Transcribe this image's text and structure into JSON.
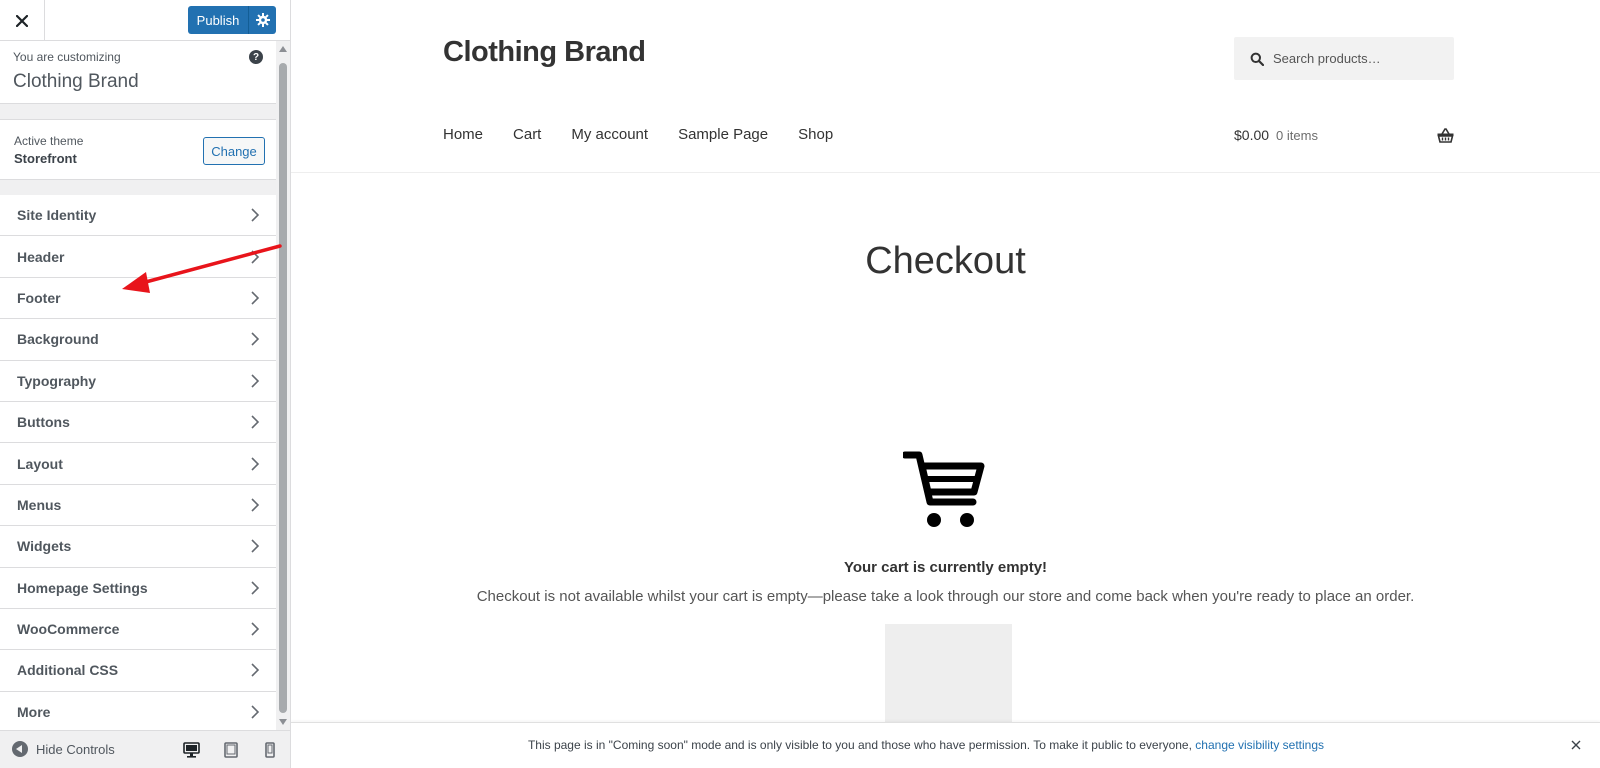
{
  "customizer": {
    "publish_label": "Publish",
    "customizing_label": "You are customizing",
    "site_name": "Clothing Brand",
    "active_theme_label": "Active theme",
    "theme_name": "Storefront",
    "change_label": "Change",
    "sections": [
      {
        "label": "Site Identity"
      },
      {
        "label": "Header"
      },
      {
        "label": "Footer"
      },
      {
        "label": "Background"
      },
      {
        "label": "Typography"
      },
      {
        "label": "Buttons"
      },
      {
        "label": "Layout"
      },
      {
        "label": "Menus"
      },
      {
        "label": "Widgets"
      },
      {
        "label": "Homepage Settings"
      },
      {
        "label": "WooCommerce"
      },
      {
        "label": "Additional CSS"
      },
      {
        "label": "More"
      }
    ],
    "hide_controls_label": "Hide Controls"
  },
  "preview": {
    "site_title": "Clothing Brand",
    "search_placeholder": "Search products…",
    "nav": [
      {
        "label": "Home"
      },
      {
        "label": "Cart"
      },
      {
        "label": "My account"
      },
      {
        "label": "Sample Page"
      },
      {
        "label": "Shop"
      }
    ],
    "cart_amount": "$0.00",
    "cart_count": "0 items",
    "page_title": "Checkout",
    "empty_title": "Your cart is currently empty!",
    "empty_message": "Checkout is not available whilst your cart is empty—please take a look through our store and come back when you're ready to place an order."
  },
  "notice": {
    "message": "This page is in \"Coming soon\" mode and is only visible to you and those who have permission. To make it public to everyone,",
    "link_text": "change visibility settings"
  },
  "colors": {
    "accent": "#2271b1",
    "annotation_arrow": "#e8141b"
  }
}
